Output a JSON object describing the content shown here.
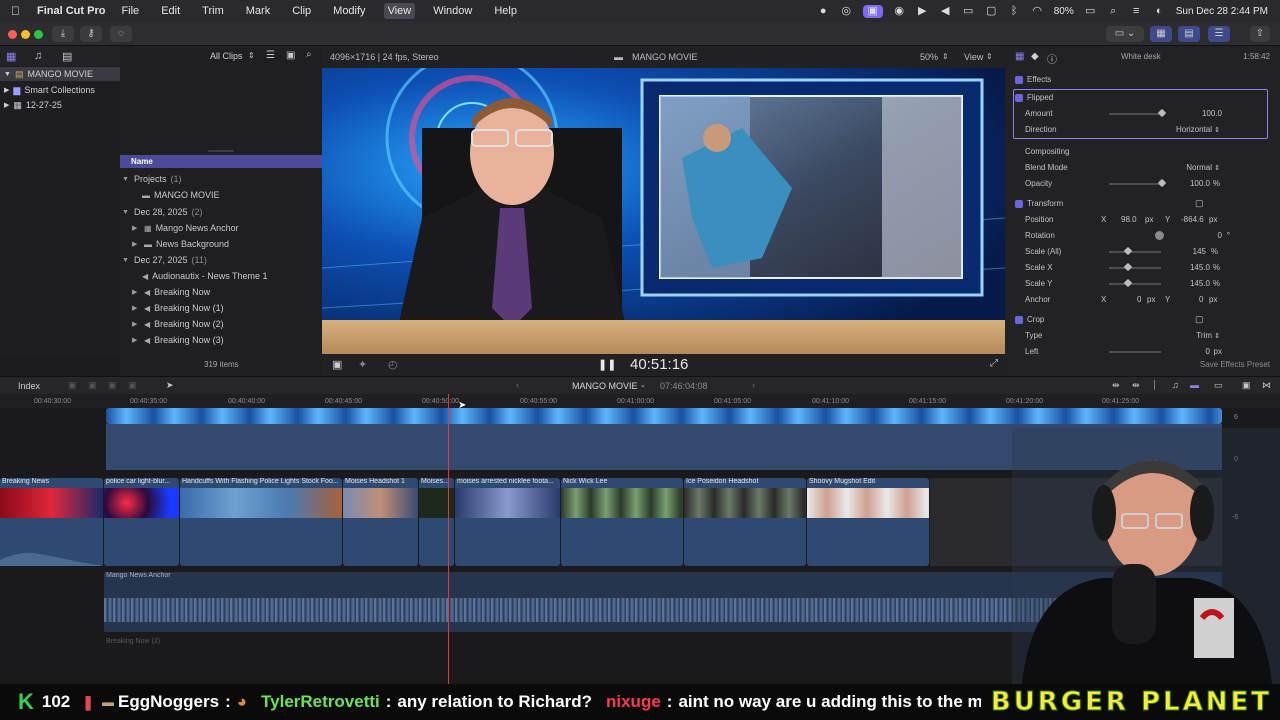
{
  "menubar": {
    "app_name": "Final Cut Pro",
    "items": [
      "File",
      "Edit",
      "Trim",
      "Mark",
      "Clip",
      "Modify",
      "View",
      "Window",
      "Help"
    ],
    "active_item": "View",
    "battery": "80%",
    "clock": "Sun Dec 28  2:44 PM"
  },
  "library": {
    "items": [
      {
        "label": "MANGO MOVIE"
      },
      {
        "label": "Smart Collections"
      },
      {
        "label": "12-27-25"
      }
    ]
  },
  "browser": {
    "filter": "All Clips",
    "column_header": "Name",
    "item_count": "319 items",
    "rows": [
      {
        "label": "Projects",
        "count": "(1)"
      },
      {
        "label": "MANGO MOVIE",
        "count": ""
      },
      {
        "label": "Dec 28, 2025",
        "count": "(2)"
      },
      {
        "label": "Mango News Anchor",
        "count": ""
      },
      {
        "label": "News Background",
        "count": ""
      },
      {
        "label": "Dec 27, 2025",
        "count": "(11)"
      },
      {
        "label": "Audionautix - News Theme 1",
        "count": ""
      },
      {
        "label": "Breaking Now",
        "count": ""
      },
      {
        "label": "Breaking Now (1)",
        "count": ""
      },
      {
        "label": "Breaking Now (2)",
        "count": ""
      },
      {
        "label": "Breaking Now (3)",
        "count": ""
      }
    ]
  },
  "viewer": {
    "format": "4096×1716 | 24 fps, Stereo",
    "title": "MANGO MOVIE",
    "zoom": "50%",
    "view_menu": "View",
    "timecode": "40:51:16"
  },
  "inspector": {
    "clip_name": "White desk",
    "duration": "1:58:42",
    "effects_header": "Effects",
    "flipped_label": "Flipped",
    "amount_label": "Amount",
    "amount_value": "100.0",
    "direction_label": "Direction",
    "direction_value": "Horizontal",
    "compositing_header": "Compositing",
    "blend_label": "Blend Mode",
    "blend_value": "Normal",
    "opacity_label": "Opacity",
    "opacity_value": "100.0",
    "opacity_unit": "%",
    "transform_header": "Transform",
    "position_label": "Position",
    "pos_x_label": "X",
    "pos_x": "98.0",
    "pos_y_label": "Y",
    "pos_y": "-864.6",
    "px_unit": "px",
    "rotation_label": "Rotation",
    "rotation_value": "0",
    "rotation_unit": "°",
    "scale_all_label": "Scale (All)",
    "scale_all_value": "145",
    "scale_x_label": "Scale X",
    "scale_x_value": "145.0",
    "scale_y_label": "Scale Y",
    "scale_y_value": "145.0",
    "anchor_label": "Anchor",
    "anchor_x": "0",
    "anchor_y": "0",
    "crop_header": "Crop",
    "type_label": "Type",
    "type_value": "Trim",
    "left_label": "Left",
    "left_value": "0",
    "save_preset": "Save Effects Preset"
  },
  "timeline": {
    "index_label": "Index",
    "project_title": "MANGO MOVIE",
    "project_duration": "07:46:04:08",
    "ruler": [
      "00:40:30:00",
      "00:40:35:00",
      "00:40:40:00",
      "00:40:45:00",
      "00:40:50:00",
      "00:40:55:00",
      "00:41:00:00",
      "00:41:05:00",
      "00:41:10:00",
      "00:41:15:00",
      "00:41:20:00",
      "00:41:25:00"
    ],
    "clips": [
      {
        "label": "Breaking News"
      },
      {
        "label": "police car light-blur..."
      },
      {
        "label": "Handcuffs With Flashing Police Lights Stock Foo..."
      },
      {
        "label": "Moises Headshot 1"
      },
      {
        "label": "Moises..."
      },
      {
        "label": "moises arrested nicklee foota..."
      },
      {
        "label": "Nick Wick Lee"
      },
      {
        "label": "Ice Poseidon Headshot"
      },
      {
        "label": "Shoovy Mugshot Edit"
      }
    ],
    "audio_label": "Mango News Anchor",
    "lower_label": "Breaking Now (2)",
    "meter_labels": [
      "6",
      "0",
      "-6"
    ]
  },
  "stream": {
    "k_count": "102",
    "user1": "EggNoggers",
    "user1_msg": "",
    "user2": "TylerRetrovetti",
    "user2_msg": "any relation to Richard?",
    "user3": "nixuge",
    "user3_msg": "aint no way are u adding this to the movie",
    "sponsor": "BURGER PLANET"
  }
}
